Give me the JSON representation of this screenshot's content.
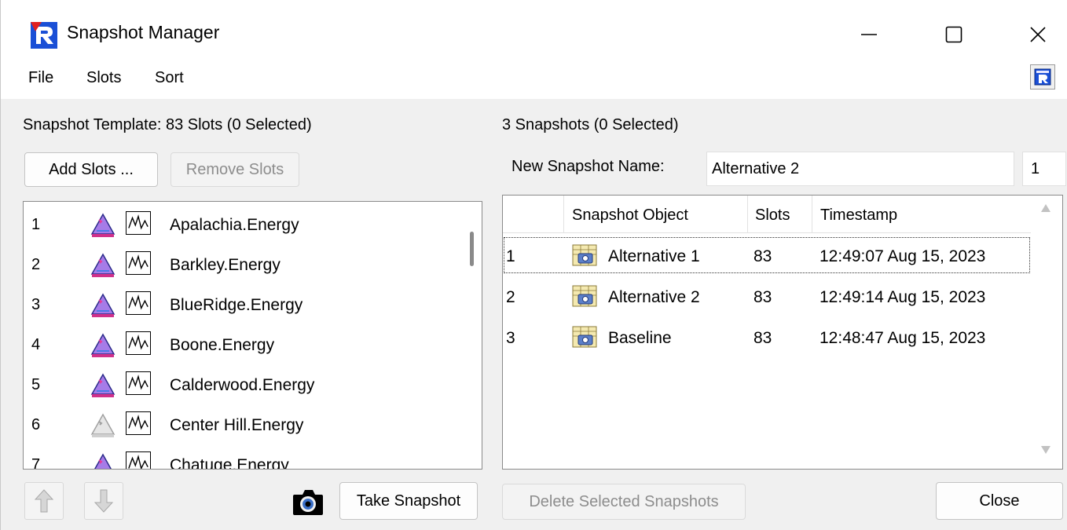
{
  "window": {
    "title": "Snapshot Manager",
    "app_icon": "riverware-logo-icon",
    "controls": {
      "minimize": "minimize-icon",
      "maximize": "maximize-icon",
      "close": "close-icon"
    }
  },
  "menu": {
    "items": [
      "File",
      "Slots",
      "Sort"
    ],
    "help_icon": "riverware-help-icon"
  },
  "template": {
    "label": "Snapshot Template: 83 Slots (0 Selected)",
    "add_button": "Add Slots ...",
    "remove_button": "Remove Slots",
    "slots": [
      {
        "index": "1",
        "name": "Apalachia.Energy",
        "icon": "reservoir-icon"
      },
      {
        "index": "2",
        "name": "Barkley.Energy",
        "icon": "reservoir-icon"
      },
      {
        "index": "3",
        "name": "BlueRidge.Energy",
        "icon": "reservoir-icon"
      },
      {
        "index": "4",
        "name": "Boone.Energy",
        "icon": "reservoir-icon"
      },
      {
        "index": "5",
        "name": "Calderwood.Energy",
        "icon": "reservoir-icon"
      },
      {
        "index": "6",
        "name": "Center Hill.Energy",
        "icon": "reservoir-disabled-icon"
      },
      {
        "index": "7",
        "name": "Chatuge.Energy",
        "icon": "reservoir-icon"
      }
    ]
  },
  "snapshots": {
    "label": "3 Snapshots (0 Selected)",
    "new_name_label": "New Snapshot Name:",
    "new_name_value": "Alternative 2",
    "counter_value": "1",
    "columns": [
      "",
      "Snapshot Object",
      "Slots",
      "Timestamp"
    ],
    "rows": [
      {
        "index": "1",
        "name": "Alternative 1",
        "slots": "83",
        "timestamp": "12:49:07 Aug 15, 2023"
      },
      {
        "index": "2",
        "name": "Alternative 2",
        "slots": "83",
        "timestamp": "12:49:14 Aug 15, 2023"
      },
      {
        "index": "3",
        "name": "Baseline",
        "slots": "83",
        "timestamp": "12:48:47 Aug 15, 2023"
      }
    ]
  },
  "bottom": {
    "take_snapshot": "Take Snapshot",
    "delete_selected": "Delete Selected Snapshots",
    "close": "Close"
  }
}
